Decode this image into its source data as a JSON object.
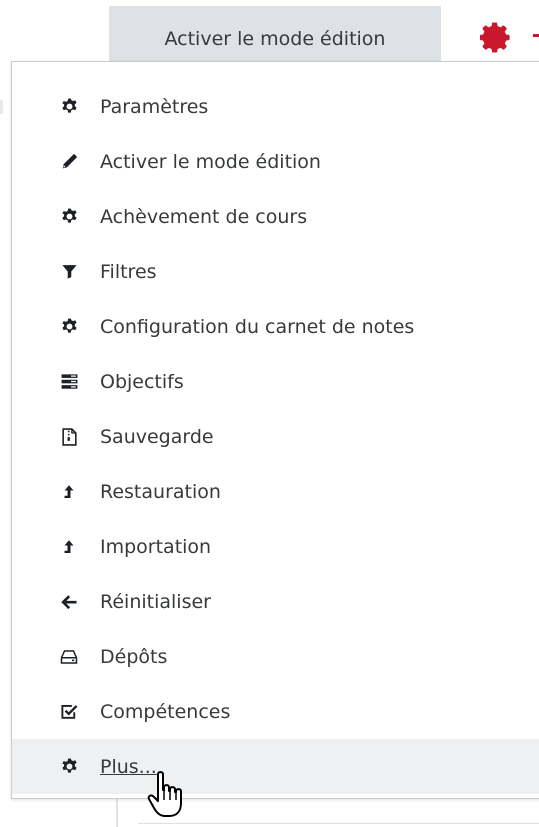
{
  "toolbar": {
    "edit_mode_label": "Activer le mode édition",
    "gear_icon": "gear-icon",
    "accent_color": "#c8182c"
  },
  "menu": {
    "items": [
      {
        "label": "Paramètres",
        "icon": "gear-icon"
      },
      {
        "label": "Activer le mode édition",
        "icon": "pencil-icon"
      },
      {
        "label": "Achèvement de cours",
        "icon": "gear-icon"
      },
      {
        "label": "Filtres",
        "icon": "filter-icon"
      },
      {
        "label": "Configuration du carnet de notes",
        "icon": "gear-icon"
      },
      {
        "label": "Objectifs",
        "icon": "list-icon"
      },
      {
        "label": "Sauvegarde",
        "icon": "archive-file-icon"
      },
      {
        "label": "Restauration",
        "icon": "upload-arrow-icon"
      },
      {
        "label": "Importation",
        "icon": "upload-arrow-icon"
      },
      {
        "label": "Réinitialiser",
        "icon": "arrow-left-icon"
      },
      {
        "label": "Dépôts",
        "icon": "hard-drive-icon"
      },
      {
        "label": "Compétences",
        "icon": "checkbox-icon"
      },
      {
        "label": "Plus...",
        "icon": "gear-icon"
      }
    ]
  },
  "colors": {
    "menu_hover_background": "#eef0f2",
    "toolbar_button_background": "#dee2e6",
    "text": "#373a3c",
    "icon": "#1d2125"
  },
  "cursor": "hand-pointer-cursor"
}
